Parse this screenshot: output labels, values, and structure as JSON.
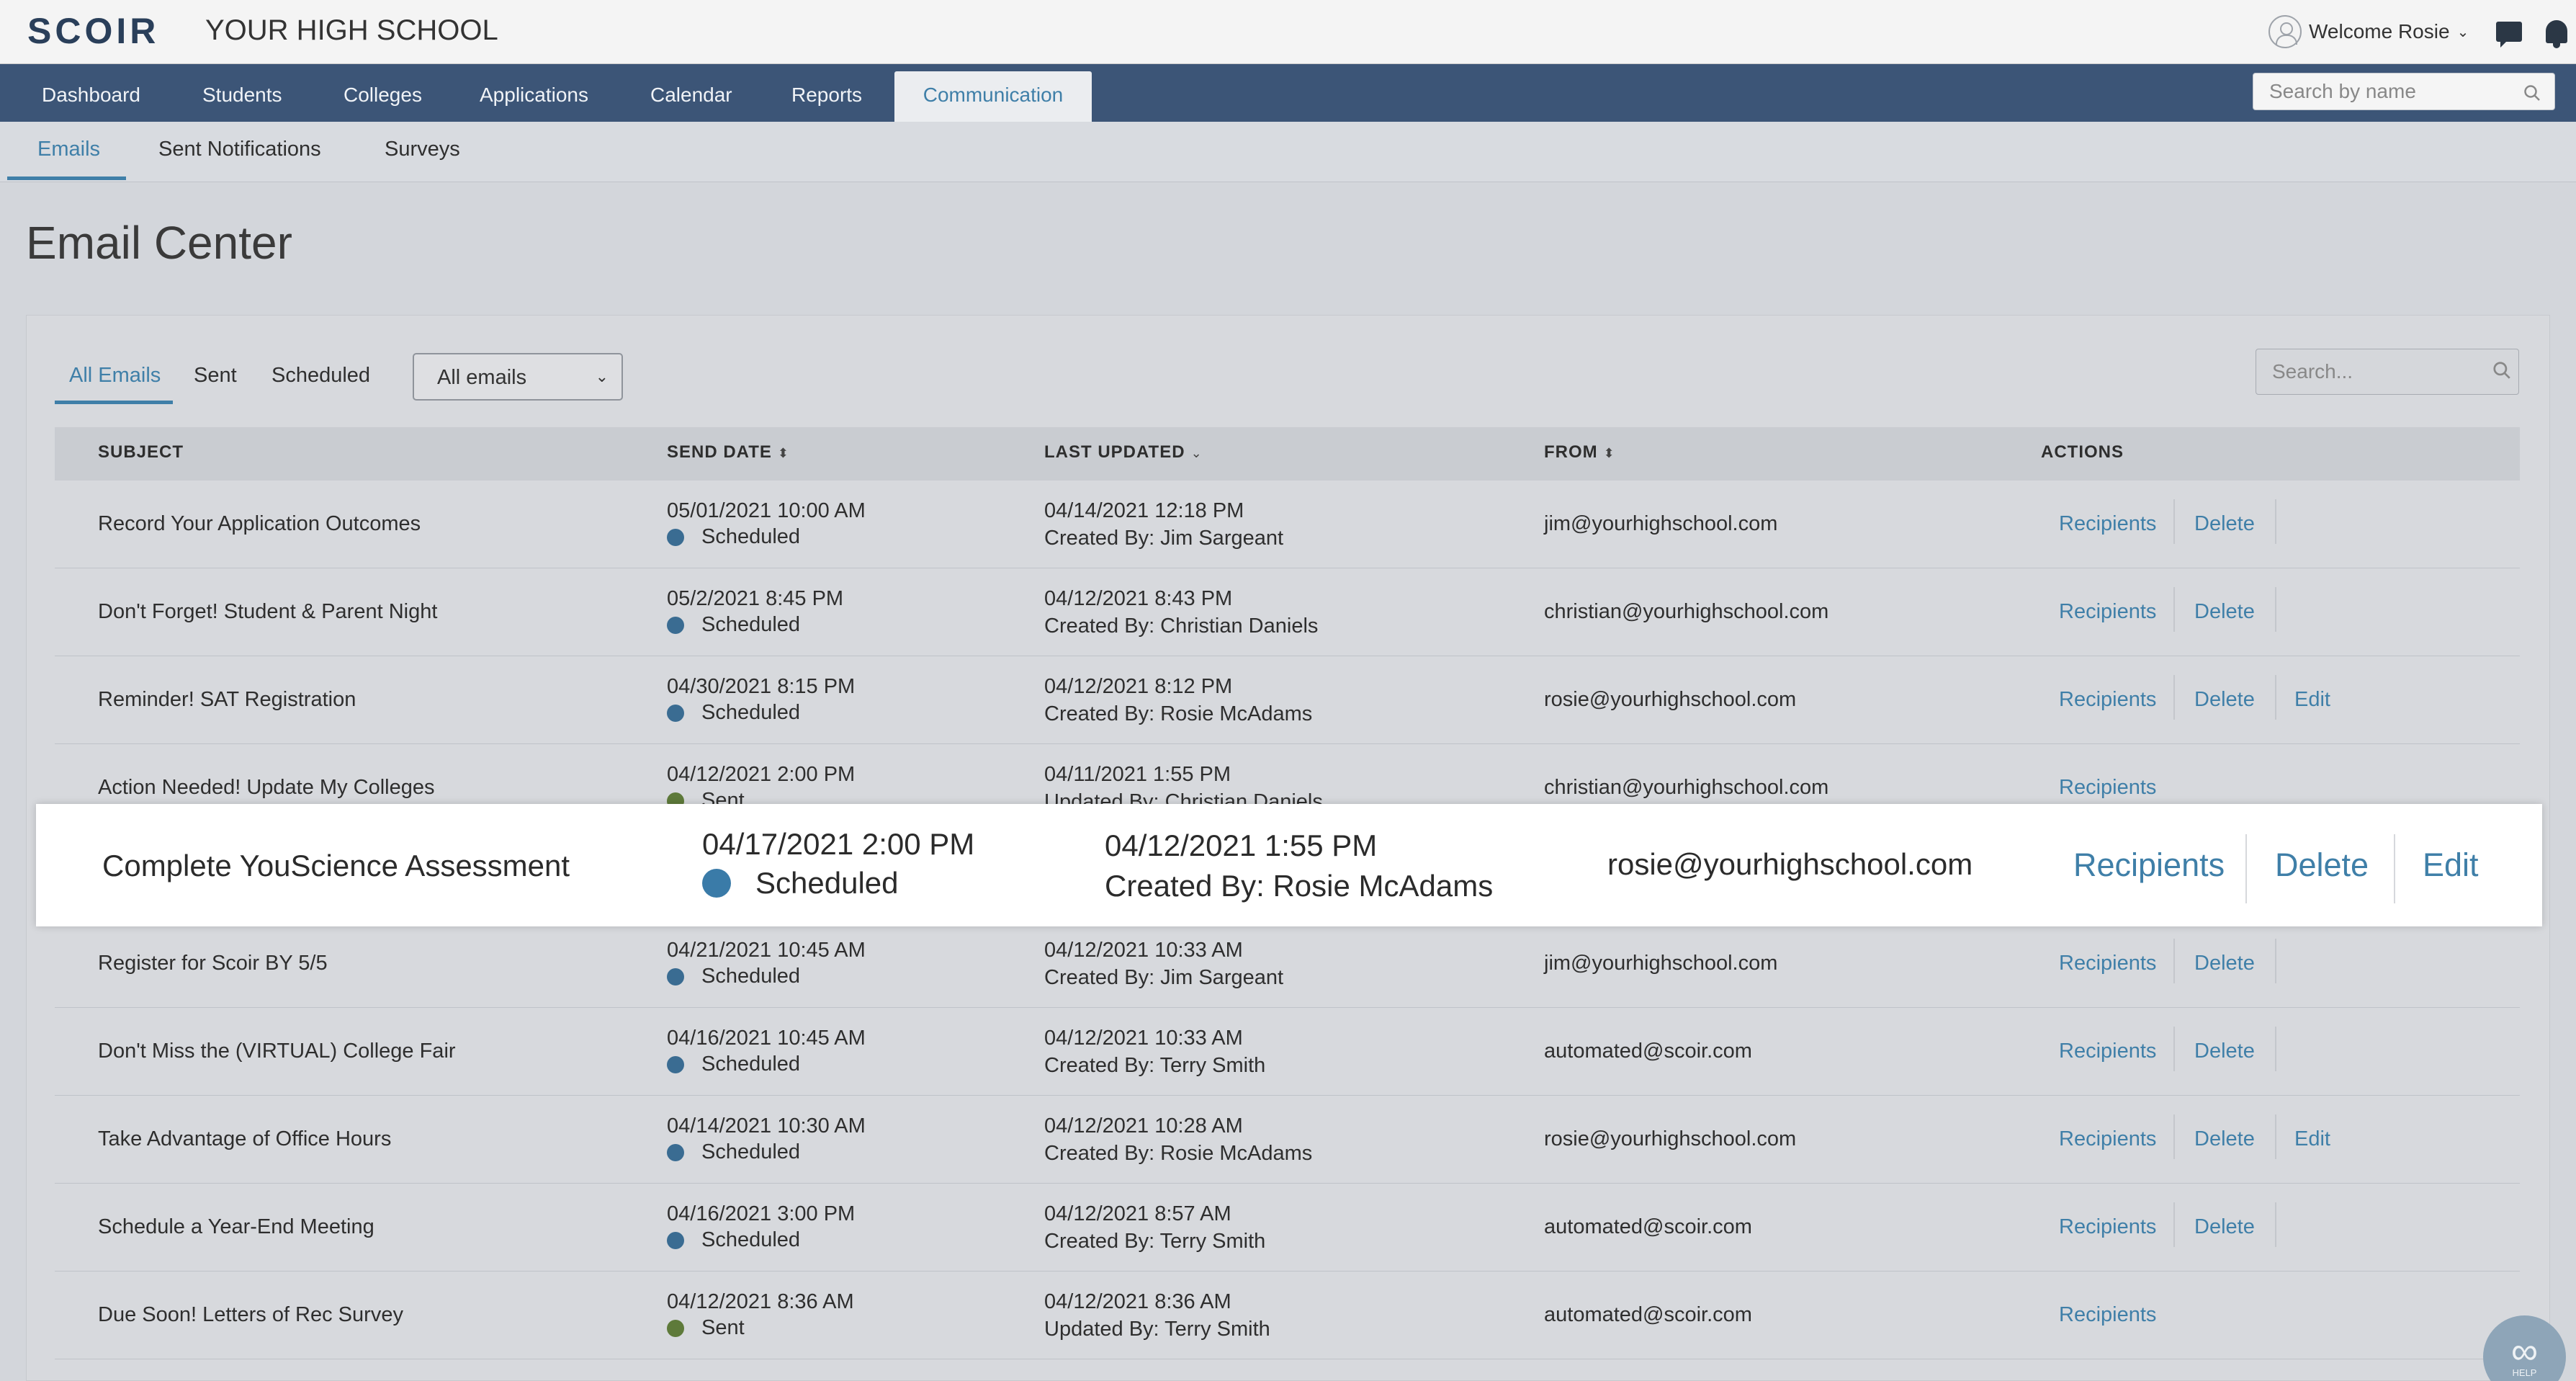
{
  "app": {
    "logo": "SCOIR",
    "school_name": "YOUR HIGH SCHOOL"
  },
  "user": {
    "welcome": "Welcome Rosie"
  },
  "icons": {
    "avatar": "user-circle-icon",
    "messages": "chat-bubble-icon",
    "notifications": "bell-icon",
    "search": "magnifier-icon",
    "sort": "sort-arrows-icon",
    "dropdown": "chevron-down-icon",
    "help": "infinity-icon"
  },
  "nav": {
    "items": [
      {
        "label": "Dashboard"
      },
      {
        "label": "Students"
      },
      {
        "label": "Colleges"
      },
      {
        "label": "Applications"
      },
      {
        "label": "Calendar"
      },
      {
        "label": "Reports"
      },
      {
        "label": "Communication",
        "active": true
      }
    ],
    "search_placeholder": "Search by name"
  },
  "subnav": {
    "items": [
      {
        "label": "Emails",
        "active": true
      },
      {
        "label": "Sent Notifications"
      },
      {
        "label": "Surveys"
      }
    ]
  },
  "page": {
    "title": "Email Center"
  },
  "filters": {
    "tabs": [
      {
        "label": "All Emails",
        "active": true
      },
      {
        "label": "Sent"
      },
      {
        "label": "Scheduled"
      }
    ],
    "select_value": "All emails",
    "search_placeholder": "Search..."
  },
  "table": {
    "headers": {
      "subject": "SUBJECT",
      "send_date": "SEND DATE",
      "last_updated": "LAST UPDATED",
      "from": "FROM",
      "actions": "ACTIONS"
    },
    "action_labels": {
      "recipients": "Recipients",
      "delete": "Delete",
      "edit": "Edit"
    },
    "rows": [
      {
        "subject": "Record Your Application Outcomes",
        "send_date": "05/01/2021 10:00 AM",
        "status": "Scheduled",
        "updated": "04/14/2021 12:18 PM",
        "updated_by": "Created By: Jim Sargeant",
        "from": "jim@yourhighschool.com",
        "actions": [
          "Recipients",
          "Delete"
        ]
      },
      {
        "subject": "Don't Forget! Student & Parent Night",
        "send_date": "05/2/2021 8:45 PM",
        "status": "Scheduled",
        "updated": "04/12/2021 8:43 PM",
        "updated_by": "Created By: Christian Daniels",
        "from": "christian@yourhighschool.com",
        "actions": [
          "Recipients",
          "Delete"
        ]
      },
      {
        "subject": "Reminder! SAT Registration",
        "send_date": "04/30/2021 8:15 PM",
        "status": "Scheduled",
        "updated": "04/12/2021 8:12 PM",
        "updated_by": "Created By: Rosie McAdams",
        "from": "rosie@yourhighschool.com",
        "actions": [
          "Recipients",
          "Delete",
          "Edit"
        ]
      },
      {
        "subject": "Action Needed! Update My Colleges",
        "send_date": "04/12/2021 2:00 PM",
        "status": "Sent",
        "updated": "04/11/2021 1:55 PM",
        "updated_by": "Updated By: Christian Daniels",
        "from": "christian@yourhighschool.com",
        "actions": [
          "Recipients"
        ]
      },
      {
        "subject": "Complete YouScience Assessment",
        "send_date": "04/17/2021 2:00 PM",
        "status": "Scheduled",
        "updated": "04/12/2021 1:55 PM",
        "updated_by": "Created By: Rosie McAdams",
        "from": "rosie@yourhighschool.com",
        "actions": [
          "Recipients",
          "Delete",
          "Edit"
        ],
        "highlighted": true
      },
      {
        "subject": "Register for Scoir BY 5/5",
        "send_date": "04/21/2021 10:45 AM",
        "status": "Scheduled",
        "updated": "04/12/2021 10:33 AM",
        "updated_by": "Created By: Jim Sargeant",
        "from": "jim@yourhighschool.com",
        "actions": [
          "Recipients",
          "Delete"
        ]
      },
      {
        "subject": "Don't Miss the (VIRTUAL) College Fair",
        "send_date": "04/16/2021 10:45 AM",
        "status": "Scheduled",
        "updated": "04/12/2021 10:33 AM",
        "updated_by": "Created By: Terry Smith",
        "from": "automated@scoir.com",
        "actions": [
          "Recipients",
          "Delete"
        ]
      },
      {
        "subject": "Take Advantage of Office Hours",
        "send_date": "04/14/2021 10:30 AM",
        "status": "Scheduled",
        "updated": "04/12/2021 10:28 AM",
        "updated_by": "Created By: Rosie McAdams",
        "from": "rosie@yourhighschool.com",
        "actions": [
          "Recipients",
          "Delete",
          "Edit"
        ]
      },
      {
        "subject": "Schedule a Year-End Meeting",
        "send_date": "04/16/2021 3:00 PM",
        "status": "Scheduled",
        "updated": "04/12/2021 8:57 AM",
        "updated_by": "Created By: Terry Smith",
        "from": "automated@scoir.com",
        "actions": [
          "Recipients",
          "Delete"
        ]
      },
      {
        "subject": "Due Soon! Letters of Rec Survey",
        "send_date": "04/12/2021 8:36 AM",
        "status": "Sent",
        "updated": "04/12/2021 8:36 AM",
        "updated_by": "Updated By: Terry Smith",
        "from": "automated@scoir.com",
        "actions": [
          "Recipients"
        ]
      }
    ]
  },
  "help": {
    "label": "HELP"
  },
  "colors": {
    "accent": "#3f7fa8",
    "nav_bg": "#3c5577",
    "scheduled_dot": "#3a6c92",
    "sent_dot": "#5e7a3a"
  }
}
